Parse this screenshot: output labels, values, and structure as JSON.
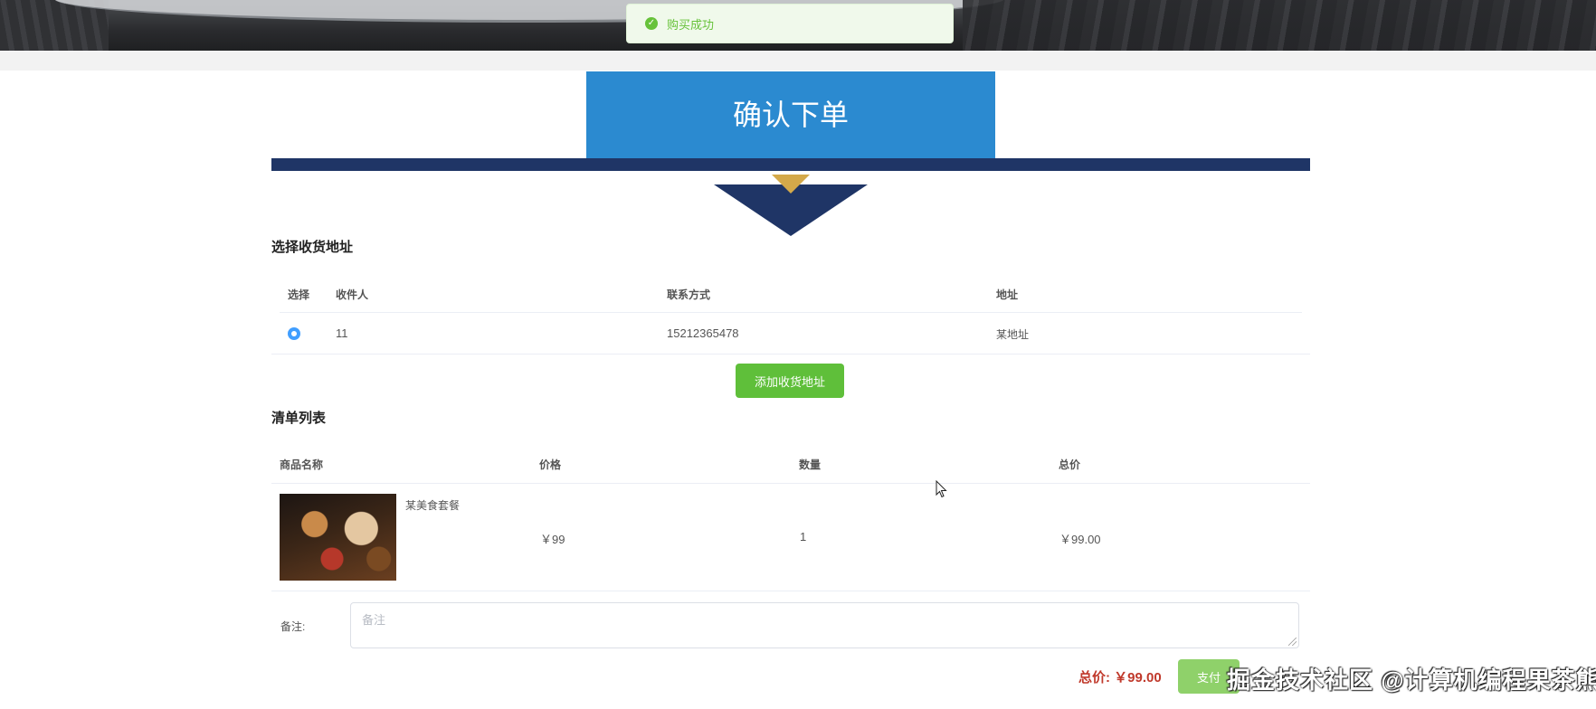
{
  "toast": {
    "message": "购买成功",
    "status_color": "#67c23a"
  },
  "banner": {
    "title": "确认下单"
  },
  "colors": {
    "banner_blue": "#2b8ad0",
    "navy": "#1f3566",
    "gold": "#d4a94a",
    "green_button": "#5fbf3a",
    "price_red": "#c0392b"
  },
  "address": {
    "section_title": "选择收货地址",
    "headers": {
      "select": "选择",
      "recipient": "收件人",
      "contact": "联系方式",
      "address": "地址"
    },
    "rows": [
      {
        "selected": true,
        "recipient": "11",
        "contact": "15212365478",
        "address": "某地址"
      }
    ],
    "add_button": "添加收货地址"
  },
  "order": {
    "section_title": "清单列表",
    "headers": {
      "name": "商品名称",
      "price": "价格",
      "quantity": "数量",
      "subtotal": "总价"
    },
    "items": [
      {
        "name": "某美食套餐",
        "price": "￥99",
        "quantity": "1",
        "subtotal": "￥99.00",
        "image_icon": "food-photo"
      }
    ]
  },
  "remark": {
    "label": "备注:",
    "placeholder": "备注",
    "value": ""
  },
  "footer": {
    "total_label": "总价: ￥99.00",
    "pay_button": "支付"
  },
  "watermark": "掘金技术社区 @计算机编程果茶熊"
}
